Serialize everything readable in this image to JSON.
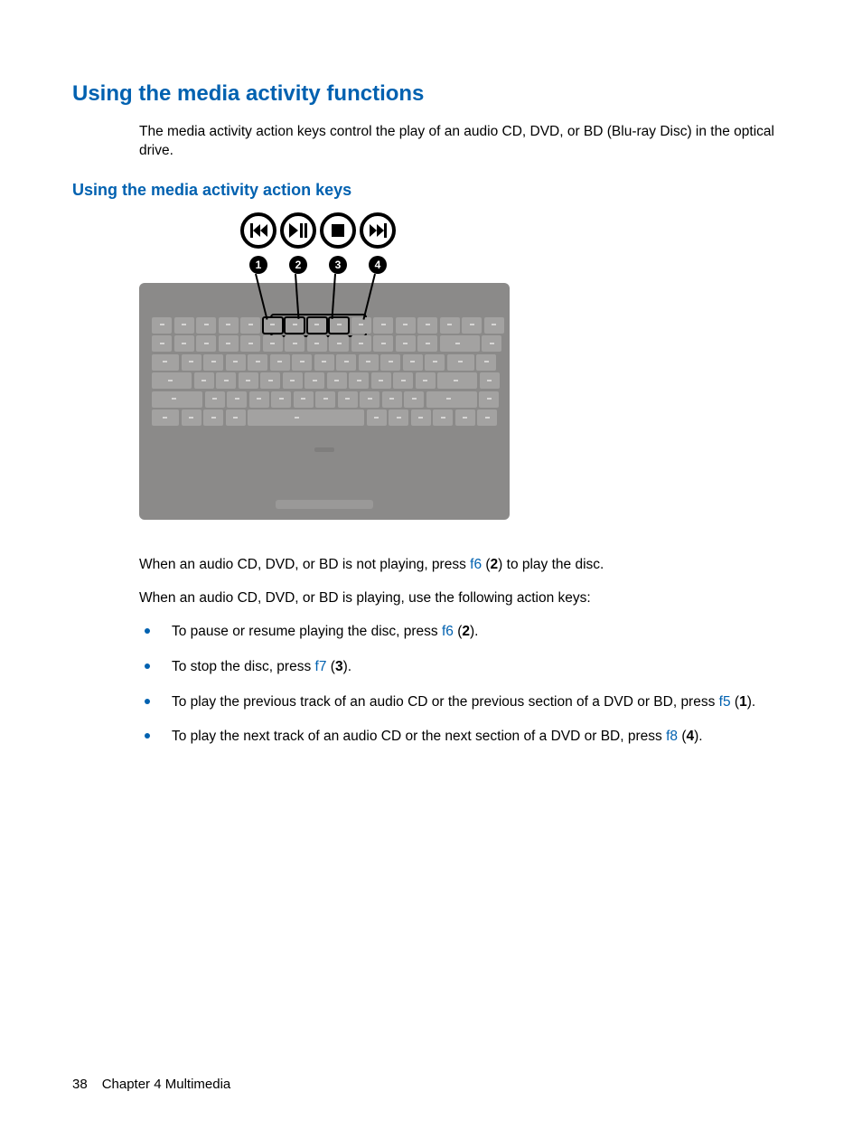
{
  "title": "Using the media activity functions",
  "intro": "The media activity action keys control the play of an audio CD, DVD, or BD (Blu-ray Disc) in the optical drive.",
  "subtitle": "Using the media activity action keys",
  "callouts": {
    "c1": "1",
    "c2": "2",
    "c3": "3",
    "c4": "4"
  },
  "para1": {
    "pre": "When an audio CD, DVD, or BD is not playing, press ",
    "key": "f6",
    "mid": " (",
    "num": "2",
    "post": ") to play the disc."
  },
  "para2": "When an audio CD, DVD, or BD is playing, use the following action keys:",
  "bullets": [
    {
      "pre": "To pause or resume playing the disc, press ",
      "key": "f6",
      "mid": " (",
      "num": "2",
      "post": ")."
    },
    {
      "pre": "To stop the disc, press ",
      "key": "f7",
      "mid": " (",
      "num": "3",
      "post": ")."
    },
    {
      "pre": "To play the previous track of an audio CD or the previous section of a DVD or BD, press ",
      "key": "f5",
      "mid": " (",
      "num": "1",
      "post": ")."
    },
    {
      "pre": "To play the next track of an audio CD or the next section of a DVD or BD, press ",
      "key": "f8",
      "mid": " (",
      "num": "4",
      "post": ")."
    }
  ],
  "footer": {
    "page": "38",
    "chapter": "Chapter 4   Multimedia"
  }
}
